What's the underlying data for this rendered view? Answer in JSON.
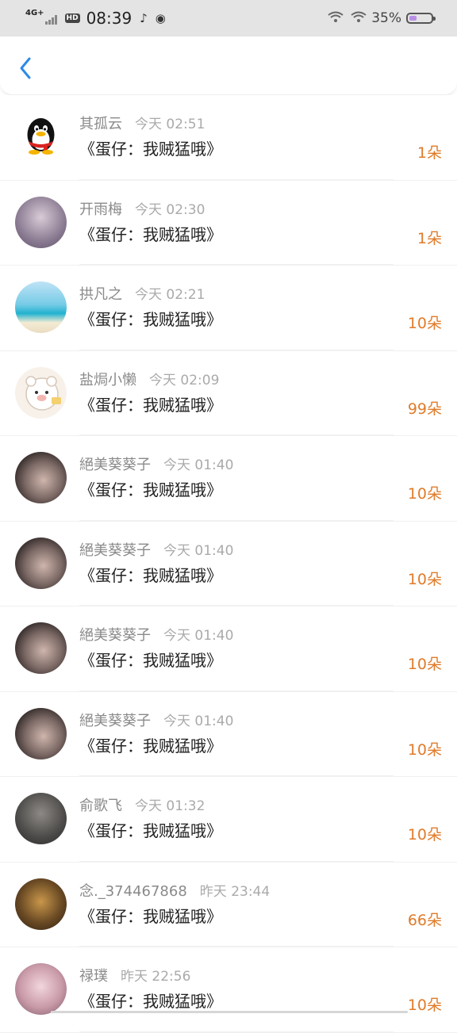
{
  "status_bar": {
    "network": "4G+",
    "hd": "HD",
    "time": "08:39",
    "battery_pct": "35%",
    "battery_level": 0.35
  },
  "nav": {
    "back_icon": "chevron-left-icon",
    "accent_color": "#2d8be6"
  },
  "list": [
    {
      "avatar": "qq-penguin",
      "name": "其孤云",
      "time": "今天 02:51",
      "title": "《蛋仔：我贼猛哦》",
      "amount": "1朵"
    },
    {
      "avatar": "anime-girl",
      "name": "开雨梅",
      "time": "今天 02:30",
      "title": "《蛋仔：我贼猛哦》",
      "amount": "1朵"
    },
    {
      "avatar": "beach",
      "name": "拱凡之",
      "time": "今天 02:21",
      "title": "《蛋仔：我贼猛哦》",
      "amount": "10朵"
    },
    {
      "avatar": "cartoon-bear",
      "name": "盐焗小懒",
      "time": "今天 02:09",
      "title": "《蛋仔：我贼猛哦》",
      "amount": "99朵"
    },
    {
      "avatar": "girl-photo",
      "name": "絕美葵葵子",
      "time": "今天 01:40",
      "title": "《蛋仔：我贼猛哦》",
      "amount": "10朵"
    },
    {
      "avatar": "girl-photo",
      "name": "絕美葵葵子",
      "time": "今天 01:40",
      "title": "《蛋仔：我贼猛哦》",
      "amount": "10朵"
    },
    {
      "avatar": "girl-photo",
      "name": "絕美葵葵子",
      "time": "今天 01:40",
      "title": "《蛋仔：我贼猛哦》",
      "amount": "10朵"
    },
    {
      "avatar": "girl-photo",
      "name": "絕美葵葵子",
      "time": "今天 01:40",
      "title": "《蛋仔：我贼猛哦》",
      "amount": "10朵"
    },
    {
      "avatar": "dark-photo",
      "name": "俞歌飞",
      "time": "今天 01:32",
      "title": "《蛋仔：我贼猛哦》",
      "amount": "10朵"
    },
    {
      "avatar": "sunset-photo",
      "name": "念._374467868",
      "time": "昨天 23:44",
      "title": "《蛋仔：我贼猛哦》",
      "amount": "66朵"
    },
    {
      "avatar": "pink-photo",
      "name": "禄璞",
      "time": "昨天 22:56",
      "title": "《蛋仔：我贼猛哦》",
      "amount": "10朵"
    }
  ],
  "colors": {
    "amount": "#e07b2a",
    "name": "#8a8a8a",
    "timestamp": "#aaaaaa",
    "title": "#222222"
  }
}
